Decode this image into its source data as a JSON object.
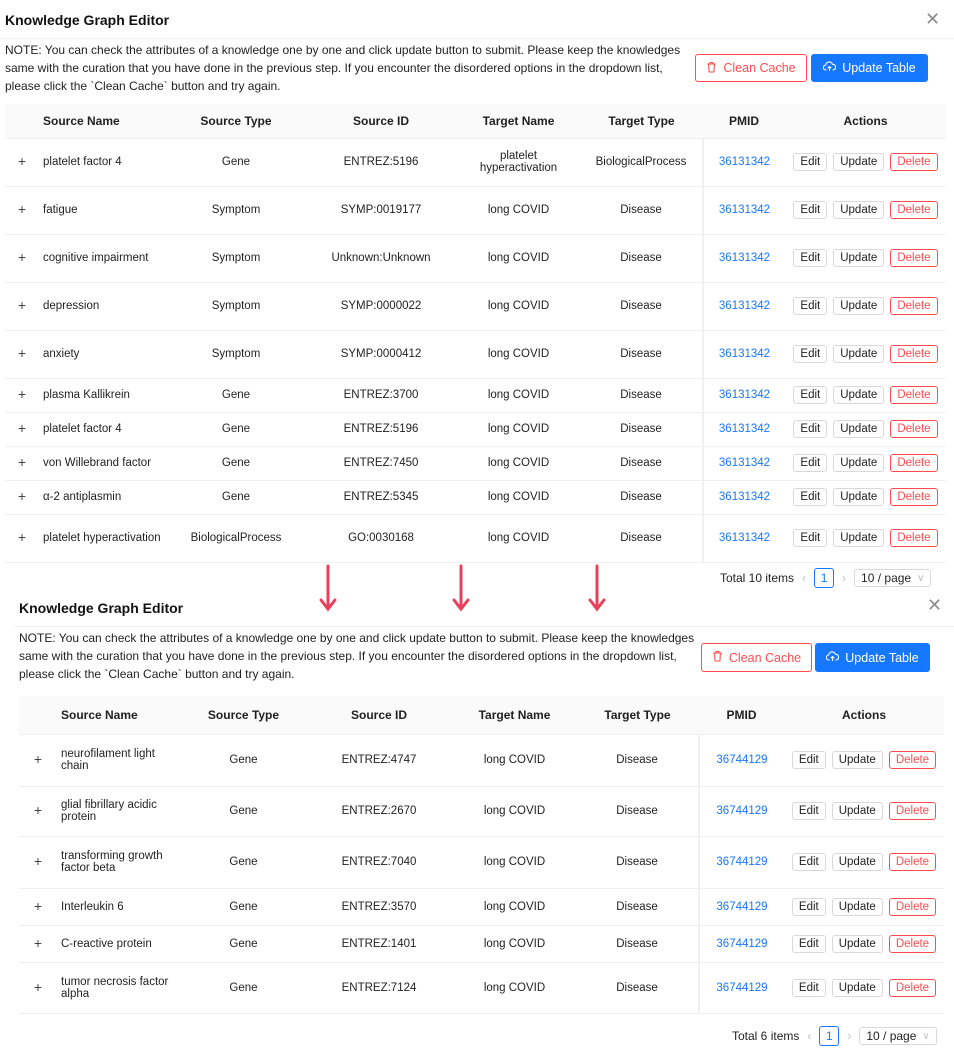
{
  "colors": {
    "accent": "#1677ff",
    "danger": "#ff4d4f",
    "arrow": "#e8415b"
  },
  "top": {
    "title": "Knowledge Graph Editor",
    "note": "NOTE: You can check the attributes of a knowledge one by one and click update button to submit. Please keep the knowledges same with the curation that you have done in the previous step. If you encounter the disordered options in the dropdown list, please click the `Clean Cache` button and try again.",
    "clean_cache_label": "Clean Cache",
    "update_table_label": "Update Table",
    "columns": [
      "Source Name",
      "Source Type",
      "Source ID",
      "Target Name",
      "Target Type",
      "PMID",
      "Actions"
    ],
    "rows": [
      {
        "source_name": "platelet factor 4",
        "source_type": "Gene",
        "source_id": "ENTREZ:5196",
        "target_name": "platelet hyperactivation",
        "target_type": "BiologicalProcess",
        "pmid": "36131342"
      },
      {
        "source_name": "fatigue",
        "source_type": "Symptom",
        "source_id": "SYMP:0019177",
        "target_name": "long COVID",
        "target_type": "Disease",
        "pmid": "36131342"
      },
      {
        "source_name": "cognitive impairment",
        "source_type": "Symptom",
        "source_id": "Unknown:Unknown",
        "target_name": "long COVID",
        "target_type": "Disease",
        "pmid": "36131342"
      },
      {
        "source_name": "depression",
        "source_type": "Symptom",
        "source_id": "SYMP:0000022",
        "target_name": "long COVID",
        "target_type": "Disease",
        "pmid": "36131342"
      },
      {
        "source_name": "anxiety",
        "source_type": "Symptom",
        "source_id": "SYMP:0000412",
        "target_name": "long COVID",
        "target_type": "Disease",
        "pmid": "36131342"
      },
      {
        "source_name": "plasma Kallikrein",
        "source_type": "Gene",
        "source_id": "ENTREZ:3700",
        "target_name": "long COVID",
        "target_type": "Disease",
        "pmid": "36131342"
      },
      {
        "source_name": "platelet factor 4",
        "source_type": "Gene",
        "source_id": "ENTREZ:5196",
        "target_name": "long COVID",
        "target_type": "Disease",
        "pmid": "36131342"
      },
      {
        "source_name": "von Willebrand factor",
        "source_type": "Gene",
        "source_id": "ENTREZ:7450",
        "target_name": "long COVID",
        "target_type": "Disease",
        "pmid": "36131342"
      },
      {
        "source_name": "α-2 antiplasmin",
        "source_type": "Gene",
        "source_id": "ENTREZ:5345",
        "target_name": "long COVID",
        "target_type": "Disease",
        "pmid": "36131342"
      },
      {
        "source_name": "platelet hyperactivation",
        "source_type": "BiologicalProcess",
        "source_id": "GO:0030168",
        "target_name": "long COVID",
        "target_type": "Disease",
        "pmid": "36131342"
      }
    ],
    "actions": {
      "edit": "Edit",
      "update": "Update",
      "delete": "Delete"
    },
    "pagination": {
      "total": "Total 10 items",
      "page": "1",
      "page_size": "10 / page"
    }
  },
  "bottom": {
    "title": "Knowledge Graph Editor",
    "note": "NOTE: You can check the attributes of a knowledge one by one and click update button to submit. Please keep the knowledges same with the curation that you have done in the previous step. If you encounter the disordered options in the dropdown list, please click the `Clean Cache` button and try again.",
    "clean_cache_label": "Clean Cache",
    "update_table_label": "Update Table",
    "columns": [
      "Source Name",
      "Source Type",
      "Source ID",
      "Target Name",
      "Target Type",
      "PMID",
      "Actions"
    ],
    "rows": [
      {
        "source_name": "neurofilament light chain",
        "source_type": "Gene",
        "source_id": "ENTREZ:4747",
        "target_name": "long COVID",
        "target_type": "Disease",
        "pmid": "36744129"
      },
      {
        "source_name": "glial fibrillary acidic protein",
        "source_type": "Gene",
        "source_id": "ENTREZ:2670",
        "target_name": "long COVID",
        "target_type": "Disease",
        "pmid": "36744129"
      },
      {
        "source_name": "transforming growth factor beta",
        "source_type": "Gene",
        "source_id": "ENTREZ:7040",
        "target_name": "long COVID",
        "target_type": "Disease",
        "pmid": "36744129"
      },
      {
        "source_name": "Interleukin 6",
        "source_type": "Gene",
        "source_id": "ENTREZ:3570",
        "target_name": "long COVID",
        "target_type": "Disease",
        "pmid": "36744129"
      },
      {
        "source_name": "C-reactive protein",
        "source_type": "Gene",
        "source_id": "ENTREZ:1401",
        "target_name": "long COVID",
        "target_type": "Disease",
        "pmid": "36744129"
      },
      {
        "source_name": "tumor necrosis factor alpha",
        "source_type": "Gene",
        "source_id": "ENTREZ:7124",
        "target_name": "long COVID",
        "target_type": "Disease",
        "pmid": "36744129"
      }
    ],
    "actions": {
      "edit": "Edit",
      "update": "Update",
      "delete": "Delete"
    },
    "pagination": {
      "total": "Total 6 items",
      "page": "1",
      "page_size": "10 / page"
    }
  }
}
